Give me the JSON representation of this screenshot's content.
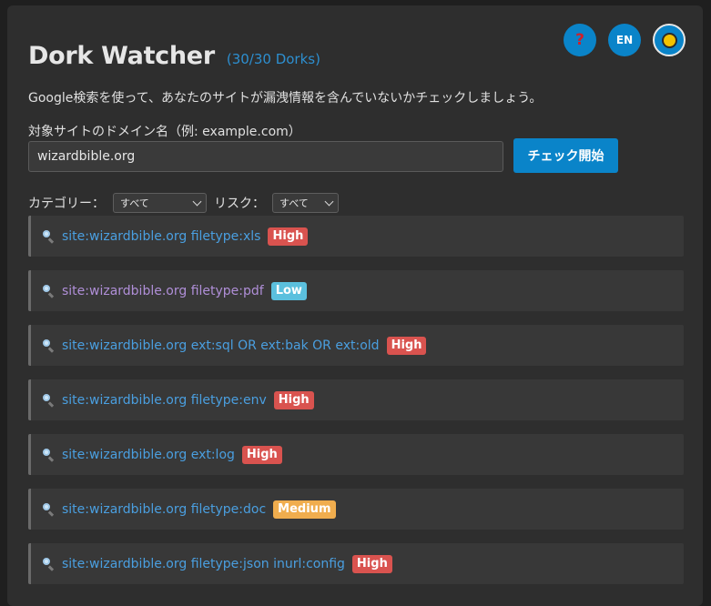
{
  "app": {
    "title": "Dork Watcher",
    "count_label": "(30/30 Dorks)",
    "description": "Google検索を使って、あなたのサイトが漏洩情報を含んでいないかチェックしましょう。"
  },
  "top_buttons": {
    "help_icon": "question-mark-icon",
    "lang_label": "EN",
    "theme_icon": "sun-icon"
  },
  "form": {
    "domain_label": "対象サイトのドメイン名（例: example.com）",
    "domain_value": "wizardbible.org",
    "check_button": "チェック開始"
  },
  "filters": {
    "category_label": "カテゴリー：",
    "category_selected": "すべて",
    "risk_label": "リスク：",
    "risk_selected": "すべて"
  },
  "risk_colors": {
    "High": "#d9534f",
    "Low": "#5bc0de",
    "Medium": "#f0ad4e"
  },
  "dorks": [
    {
      "query": "site:wizardbible.org filetype:xls",
      "risk": "High",
      "visited": false
    },
    {
      "query": "site:wizardbible.org filetype:pdf",
      "risk": "Low",
      "visited": true
    },
    {
      "query": "site:wizardbible.org ext:sql OR ext:bak OR ext:old",
      "risk": "High",
      "visited": false
    },
    {
      "query": "site:wizardbible.org filetype:env",
      "risk": "High",
      "visited": false
    },
    {
      "query": "site:wizardbible.org ext:log",
      "risk": "High",
      "visited": false
    },
    {
      "query": "site:wizardbible.org filetype:doc",
      "risk": "Medium",
      "visited": false
    },
    {
      "query": "site:wizardbible.org filetype:json inurl:config",
      "risk": "High",
      "visited": false
    }
  ]
}
